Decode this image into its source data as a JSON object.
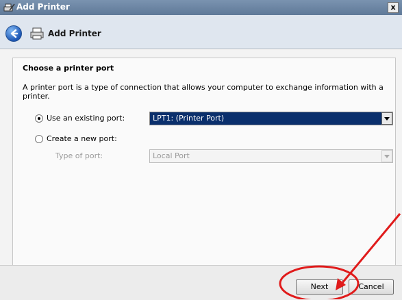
{
  "window": {
    "title": "Add Printer",
    "close_label": "x"
  },
  "nav": {
    "title": "Add Printer"
  },
  "content": {
    "heading": "Choose a printer port",
    "description": "A printer port is a type of connection that allows your computer to exchange information with a printer.",
    "option_existing": {
      "label": "Use an existing port:",
      "selected": true,
      "value": "LPT1: (Printer Port)"
    },
    "option_new": {
      "label": "Create a new port:",
      "selected": false,
      "type_label": "Type of port:",
      "type_value": "Local Port"
    }
  },
  "footer": {
    "next_label": "Next",
    "cancel_label": "Cancel"
  },
  "colors": {
    "annotation": "#e01b1b",
    "selection": "#0a2f6c"
  }
}
